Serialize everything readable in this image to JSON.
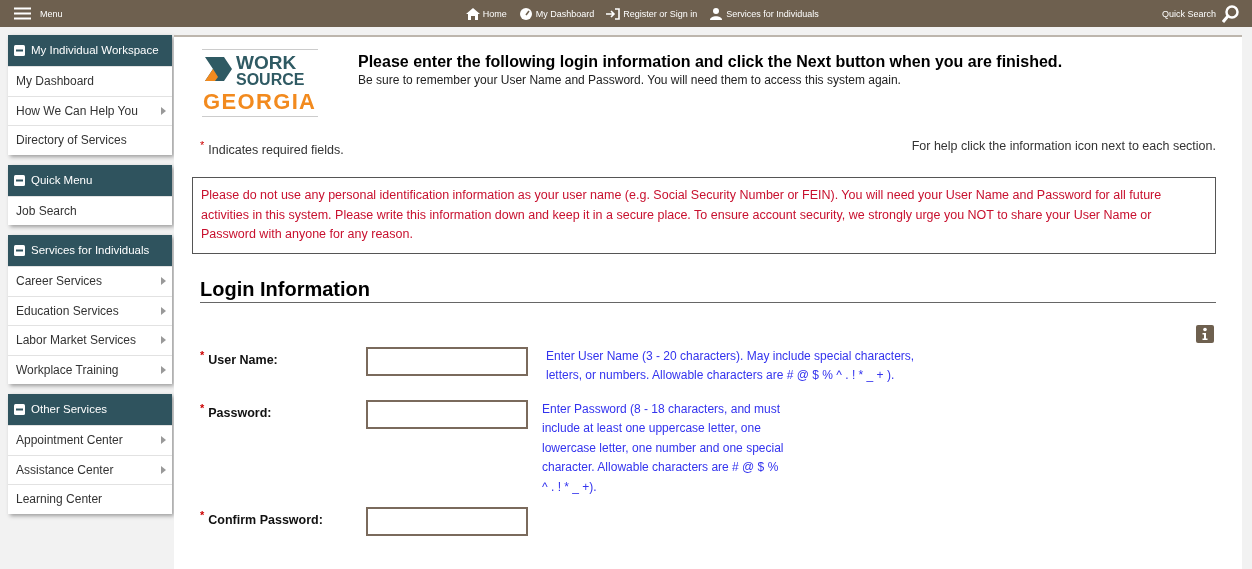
{
  "top_bar": {
    "menu": "Menu",
    "links": [
      {
        "kind": "home",
        "label": "Home"
      },
      {
        "kind": "dashboard",
        "label": "My Dashboard"
      },
      {
        "kind": "signin",
        "label": "Register or Sign in"
      },
      {
        "kind": "person",
        "label": "Services for Individuals"
      }
    ],
    "quick_search": "Quick Search"
  },
  "sidebar": [
    {
      "title": "My Individual Workspace",
      "expanded": true,
      "items": [
        {
          "label": "My Dashboard",
          "submenu": false
        },
        {
          "label": "How We Can Help You",
          "submenu": true
        },
        {
          "label": "Directory of Services",
          "submenu": false
        }
      ]
    },
    {
      "title": "Quick Menu",
      "expanded": true,
      "items": [
        {
          "label": "Job Search",
          "submenu": false
        }
      ]
    },
    {
      "title": "Services for Individuals",
      "expanded": true,
      "items": [
        {
          "label": "Career Services",
          "submenu": true
        },
        {
          "label": "Education Services",
          "submenu": true
        },
        {
          "label": "Labor Market Services",
          "submenu": true
        },
        {
          "label": "Workplace Training",
          "submenu": true
        }
      ]
    },
    {
      "title": "Other Services",
      "expanded": true,
      "items": [
        {
          "label": "Appointment Center",
          "submenu": true
        },
        {
          "label": "Assistance Center",
          "submenu": true
        },
        {
          "label": "Learning Center",
          "submenu": false
        }
      ]
    }
  ],
  "logo": {
    "line_1": "WORK",
    "line_2": "SOURCE",
    "line_3": "GEORGIA"
  },
  "heading": "Please enter the following login information and click the Next button when you are finished.",
  "subheading": "Be sure to remember your User Name and Password. You will need them to access this system again.",
  "required_note": {
    "mark": "*",
    "text": "Indicates required fields."
  },
  "help_note": "For help click the information icon next to each section.",
  "notice": "Please do not use any personal identification information as your user name (e.g. Social Security Number or FEIN). You will need your User Name and Password for all future activities in this system. Please write this information down and keep it in a secure place. To ensure account security, we strongly urge you NOT to share your User Name or Password with anyone for any reason.",
  "section_title": "Login Information",
  "fields": [
    {
      "mark": "*",
      "label": "User Name:",
      "help": "Enter User Name (3 - 20 characters). May include special characters, letters, or numbers. Allowable characters are # @ $ % ^ . ! * _ + )."
    },
    {
      "mark": "*",
      "label": "Password:",
      "help": "Enter Password (8 - 18 characters, and must include at least one uppercase letter, one lowercase letter, one number and one special character. Allowable characters are # @ $ % ^ . ! * _ +)."
    },
    {
      "mark": "*",
      "label": "Confirm Password:"
    }
  ]
}
